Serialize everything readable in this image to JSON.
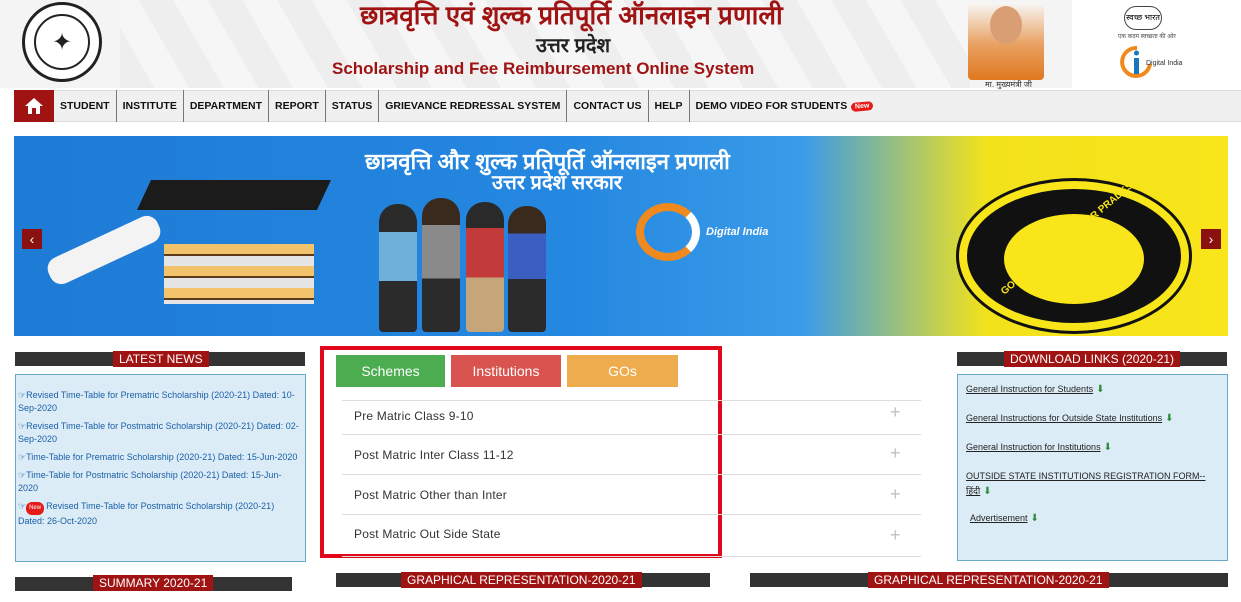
{
  "header": {
    "title_hindi": "छात्रवृत्ति एवं शुल्क प्रतिपूर्ति ऑनलाइन प्रणाली",
    "state_hindi": "उत्तर प्रदेश",
    "title_english": "Scholarship and Fee Reimbursement Online System",
    "cm_caption": "मा. मुख्यमंत्री जी",
    "sbsv_text": "स्वच्छ भारत",
    "sbsv_sub": "एक कदम स्वच्छता की ओर",
    "digital_india": "Digital India"
  },
  "nav": {
    "items": [
      {
        "label": "STUDENT"
      },
      {
        "label": "INSTITUTE"
      },
      {
        "label": "DEPARTMENT"
      },
      {
        "label": "REPORT"
      },
      {
        "label": "STATUS"
      },
      {
        "label": "GRIEVANCE REDRESSAL SYSTEM"
      },
      {
        "label": "CONTACT US"
      },
      {
        "label": "HELP"
      },
      {
        "label": "DEMO VIDEO FOR STUDENTS"
      }
    ],
    "new_badge": "New"
  },
  "banner": {
    "line1": "छात्रवृत्ति और शुल्क प्रतिपूर्ति ऑनलाइन प्रणाली",
    "line2": "उत्तर प्रदेश सरकार",
    "emblem_text": "GOVERNMENT OF UTTAR PRADESH",
    "digital_india": "Digital India",
    "prev": "‹",
    "next": "›"
  },
  "latest_news": {
    "title": "LATEST NEWS",
    "items": [
      "Revised Time-Table for Prematric Scholarship (2020-21) Dated: 10-Sep-2020",
      "Revised Time-Table for Postmatric Scholarship (2020-21) Dated: 02-Sep-2020",
      "Time-Table for Prematric Scholarship (2020-21) Dated: 15-Jun-2020",
      "Time-Table for Postmatric Scholarship (2020-21) Dated: 15-Jun-2020",
      "Revised Time-Table for Postmatric Scholarship (2020-21) Dated: 26-Oct-2020"
    ],
    "new_badge": "New"
  },
  "tabs": {
    "schemes": "Schemes",
    "institutions": "Institutions",
    "gos": "GOs",
    "items": [
      "Pre Matric Class 9-10",
      "Post Matric Inter Class 11-12",
      "Post Matric Other than Inter",
      "Post Matric Out Side State"
    ],
    "expand": "+"
  },
  "download_links": {
    "title": "DOWNLOAD LINKS (2020-21)",
    "items": [
      "General Instruction for Students",
      "General Instructions for Outside State Institutions",
      "General Instruction for Institutions",
      "OUTSIDE STATE INSTITUTIONS REGISTRATION FORM--",
      "Advertisement"
    ],
    "form_line2": "हिंदी"
  },
  "bottom": {
    "summary": "SUMMARY 2020-21",
    "graphical1": "GRAPHICAL REPRESENTATION-2020-21",
    "graphical2": "GRAPHICAL REPRESENTATION-2020-21"
  },
  "colors": {
    "brand_red": "#a01313",
    "schemes": "#4bad4f",
    "institutions": "#d9534f",
    "gos": "#efac4e",
    "highlight": "#e0081a"
  }
}
